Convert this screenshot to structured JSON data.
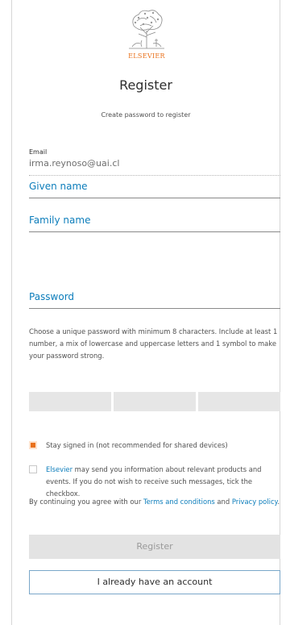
{
  "brand": {
    "logo_text": "ELSEVIER",
    "accent_color": "#e9711c",
    "link_color": "#0c7dbb"
  },
  "header": {
    "title": "Register",
    "subtitle": "Create password to register"
  },
  "form": {
    "email": {
      "label": "Email",
      "value": "irma.reynoso@uai.cl"
    },
    "given_name": {
      "placeholder": "Given name"
    },
    "family_name": {
      "placeholder": "Family name"
    },
    "password": {
      "placeholder": "Password"
    },
    "password_help": "Choose a unique password with minimum 8 characters. Include at least 1 number, a mix of lowercase and uppercase letters and 1 symbol to make your password strong."
  },
  "options": {
    "stay_signed_in": {
      "label": "Stay signed in (not recommended for shared devices)",
      "checked": true
    },
    "marketing": {
      "link_text": "Elsevier",
      "text": " may send you information about relevant products and events. If you do not wish to receive such messages, tick the checkbox.",
      "checked": false
    }
  },
  "consent": {
    "prefix": "By continuing you agree with our ",
    "terms_link": "Terms and conditions",
    "middle": " and ",
    "privacy_link": "Privacy policy",
    "suffix": "."
  },
  "buttons": {
    "register": "Register",
    "already_account": "I already have an account"
  }
}
